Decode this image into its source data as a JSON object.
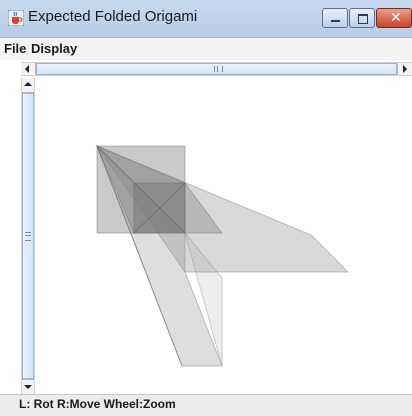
{
  "window": {
    "title": "Expected Folded Origami",
    "app_icon": "java-cup-icon",
    "controls": {
      "minimize_icon": "minimize-icon",
      "maximize_icon": "maximize-icon",
      "close_icon": "close-icon",
      "close_glyph": "✕"
    }
  },
  "menu": {
    "items": [
      {
        "label": "File"
      },
      {
        "label": "Display"
      }
    ]
  },
  "scrollbars": {
    "horizontal": {
      "left_icon": "arrow-left-icon",
      "right_icon": "arrow-right-icon",
      "grip_icon": "scroll-grip-icon"
    },
    "vertical": {
      "up_icon": "arrow-up-icon",
      "down_icon": "arrow-down-icon",
      "grip_icon": "scroll-grip-icon"
    }
  },
  "status": {
    "hint": "L: Rot R:Move Wheel:Zoom"
  },
  "colors": {
    "title_bar": "#c0d4ec",
    "close_button": "#c8442a",
    "face_fill": "#8a8a8a",
    "canvas_bg": "#ffffff"
  }
}
